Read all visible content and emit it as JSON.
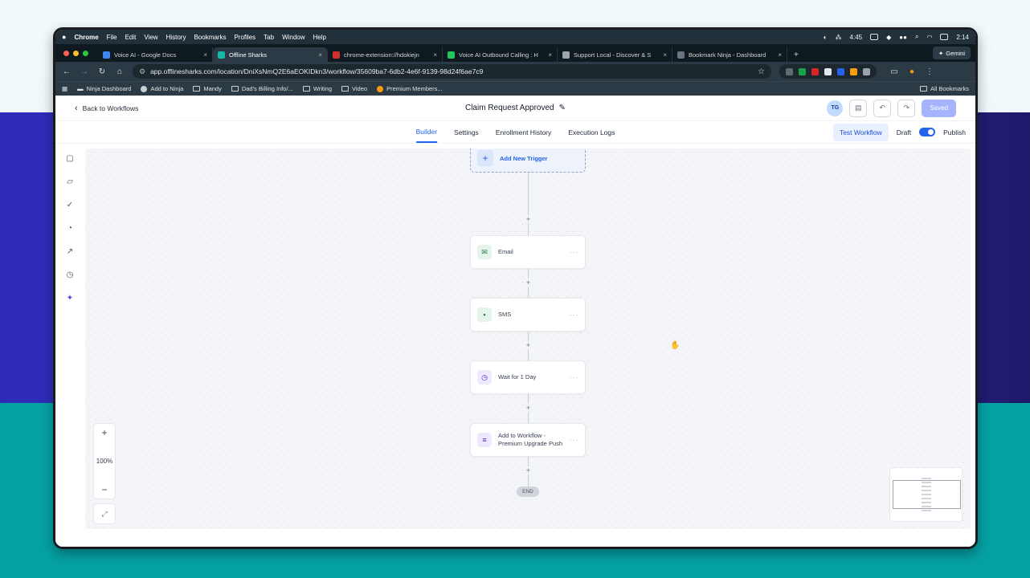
{
  "menubar": {
    "apple": "",
    "items": [
      "Chrome",
      "File",
      "Edit",
      "View",
      "History",
      "Bookmarks",
      "Profiles",
      "Tab",
      "Window",
      "Help"
    ],
    "timer": "4:45",
    "clock": "2:14"
  },
  "tabs": [
    {
      "title": "Voice AI - Google Docs",
      "color": "#4285f4",
      "active": false
    },
    {
      "title": "Offline Sharks",
      "color": "#14b8a6",
      "active": true
    },
    {
      "title": "chrome-extension://hdokiejn",
      "color": "#d32f2f",
      "active": false
    },
    {
      "title": "Voice AI Outbound Calling : H",
      "color": "#22c55e",
      "active": false
    },
    {
      "title": "Support Local - Discover & S",
      "color": "#9ca3af",
      "active": false
    },
    {
      "title": "Bookmark Ninja - Dashboard",
      "color": "#6b7280",
      "active": false
    }
  ],
  "gemini_label": "Gemini",
  "address": {
    "url": "app.offlinesharks.com/location/DniXsNmQ2E6aEOKIDkn3/workflow/35609ba7-6db2-4e6f-9139-98d24f6ae7c9"
  },
  "bookmarks": {
    "items": [
      "Ninja Dashboard",
      "Add to Ninja",
      "Mandy",
      "Dad's Billing Info/...",
      "Writing",
      "Video",
      "Premium Members..."
    ],
    "all": "All Bookmarks"
  },
  "header": {
    "back": "Back to Workflows",
    "title": "Claim Request Approved",
    "avatar": "TG",
    "saved": "Saved"
  },
  "subnav": {
    "tabs": [
      "Builder",
      "Settings",
      "Enrollment History",
      "Execution Logs"
    ],
    "test": "Test Workflow",
    "draft": "Draft",
    "publish": "Publish"
  },
  "workflow": {
    "trigger": "Add New Trigger",
    "nodes": [
      "Email",
      "SMS",
      "Wait for 1 Day",
      "Add to Workflow - Premium Upgrade Push"
    ],
    "end": "END"
  },
  "zoom": {
    "plus": "+",
    "level": "100%",
    "minus": "−"
  },
  "colors": {
    "accent": "#2563eb",
    "saved": "#a5b4fc",
    "teal_bg": "#05a2a4"
  }
}
